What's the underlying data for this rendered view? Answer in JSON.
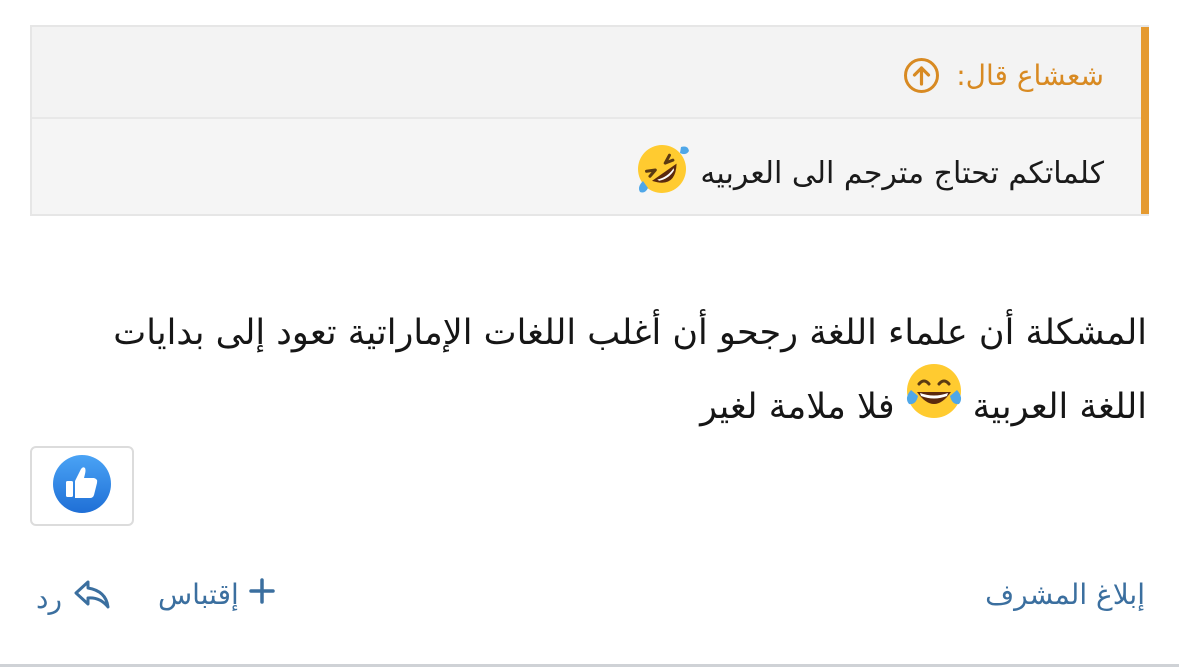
{
  "quote": {
    "author": "شعشاع قال:",
    "text": "كلماتكم تحتاج مترجم الى العربيه",
    "emoji": "rolling-on-floor-laughing-emoji"
  },
  "post": {
    "text_before_emoji": "المشكلة أن علماء اللغة رجحو أن أغلب اللغات الإماراتية تعود إلى بدايات اللغة العربية",
    "emoji": "face-with-tears-of-joy-emoji",
    "text_after_emoji": "فلا ملامة لغير"
  },
  "reaction": {
    "icon": "thumbs-up-icon",
    "color": "#2f7fdd"
  },
  "actions": {
    "report": "إبلاغ المشرف",
    "quote": "إقتباس",
    "quote_icon": "plus-icon",
    "reply": "رد",
    "reply_icon": "reply-arrow-icon"
  },
  "colors": {
    "accent": "#e59a30",
    "link": "#3b6f9f"
  }
}
